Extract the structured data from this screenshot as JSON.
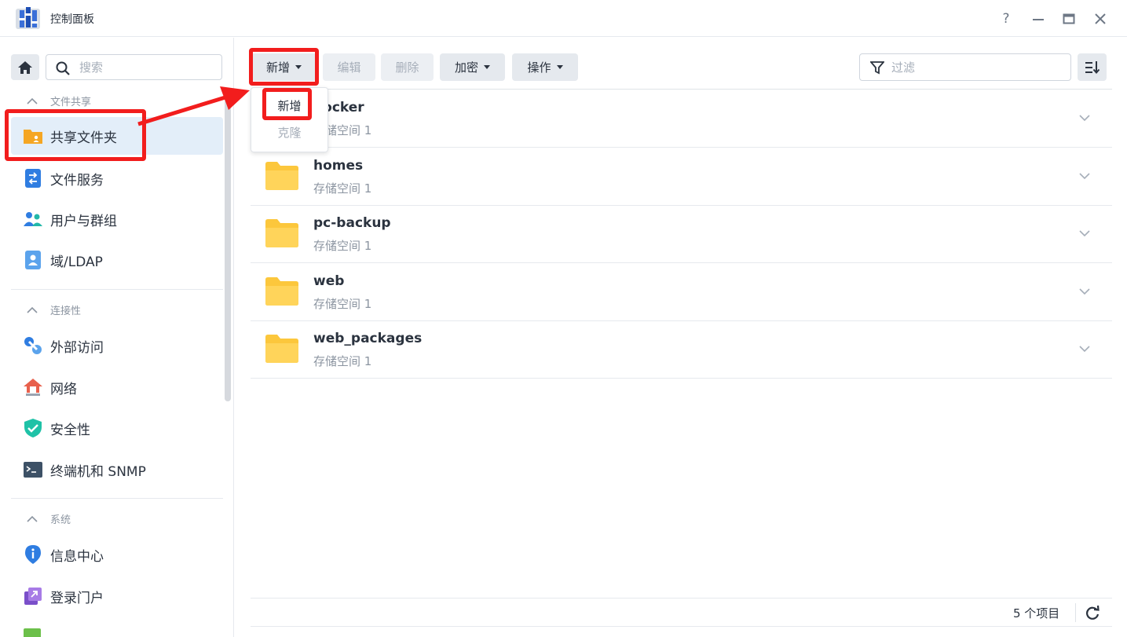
{
  "window": {
    "title": "控制面板",
    "help_label": "?"
  },
  "sidebar": {
    "search_placeholder": "搜索",
    "sections": [
      {
        "label": "文件共享",
        "items": [
          {
            "label": "共享文件夹",
            "icon": "shared-folder-icon",
            "active": true
          },
          {
            "label": "文件服务",
            "icon": "file-services-icon"
          },
          {
            "label": "用户与群组",
            "icon": "users-groups-icon"
          },
          {
            "label": "域/LDAP",
            "icon": "domain-ldap-icon"
          }
        ]
      },
      {
        "label": "连接性",
        "items": [
          {
            "label": "外部访问",
            "icon": "external-access-icon"
          },
          {
            "label": "网络",
            "icon": "network-icon"
          },
          {
            "label": "安全性",
            "icon": "security-icon"
          },
          {
            "label": "终端机和 SNMP",
            "icon": "terminal-icon"
          }
        ]
      },
      {
        "label": "系统",
        "items": [
          {
            "label": "信息中心",
            "icon": "info-center-icon"
          },
          {
            "label": "登录门户",
            "icon": "login-portal-icon"
          }
        ]
      }
    ]
  },
  "toolbar": {
    "create_label": "新增",
    "edit_label": "编辑",
    "delete_label": "删除",
    "encrypt_label": "加密",
    "action_label": "操作",
    "filter_placeholder": "过滤"
  },
  "dropdown": {
    "items": [
      {
        "label": "新增",
        "enabled": true
      },
      {
        "label": "克隆",
        "enabled": false
      }
    ]
  },
  "folders": [
    {
      "name": "docker",
      "volume": "存储空间 1"
    },
    {
      "name": "homes",
      "volume": "存储空间 1"
    },
    {
      "name": "pc-backup",
      "volume": "存储空间 1"
    },
    {
      "name": "web",
      "volume": "存储空间 1"
    },
    {
      "name": "web_packages",
      "volume": "存储空间 1"
    }
  ],
  "footer": {
    "item_count": "5 个项目"
  },
  "colors": {
    "accent": "#0086e5",
    "annotation_red": "#f21d1d",
    "folder_yellow": "#fcc73c",
    "active_bg": "#e3eef9"
  }
}
